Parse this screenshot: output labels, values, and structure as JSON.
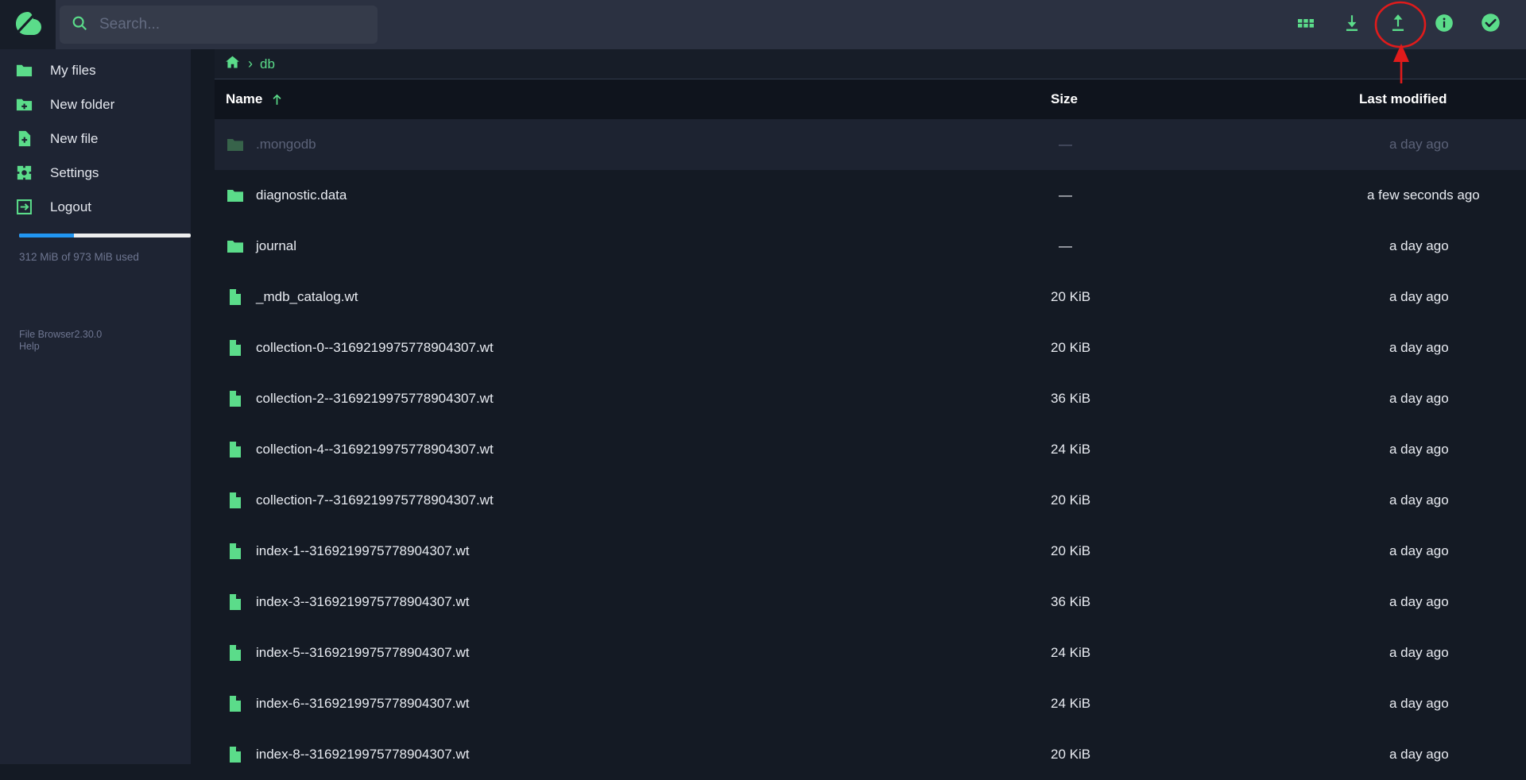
{
  "app": {
    "logo": "filebrowser-cloud-logo",
    "name": "File Browser",
    "version": "2.30.0",
    "version_line": "File Browser2.30.0",
    "help_label": "Help",
    "accent_green": "#5bdc8a",
    "accent_blue": "#2196f3",
    "annotation_red": "#e01b1b",
    "bg_dark": "#141a24",
    "bg_sidebar": "#1e2433",
    "bg_topbar": "#2b3141"
  },
  "search": {
    "placeholder": "Search...",
    "value": "",
    "icon": "search-icon"
  },
  "toolbar": {
    "items": [
      {
        "name": "switch-view-button",
        "icon": "grid-view-icon",
        "label": "Switch view"
      },
      {
        "name": "download-button",
        "icon": "download-icon",
        "label": "Download",
        "highlighted": true
      },
      {
        "name": "upload-button",
        "icon": "upload-icon",
        "label": "Upload"
      },
      {
        "name": "info-button",
        "icon": "info-icon",
        "label": "Info"
      },
      {
        "name": "select-multiple-button",
        "icon": "check-circle-icon",
        "label": "Select multiple"
      }
    ]
  },
  "sidebar": {
    "items": [
      {
        "label": "My files",
        "icon": "folder-icon",
        "name": "sidebar-item-my-files"
      },
      {
        "label": "New folder",
        "icon": "folder-plus-icon",
        "name": "sidebar-item-new-folder"
      },
      {
        "label": "New file",
        "icon": "file-plus-icon",
        "name": "sidebar-item-new-file"
      },
      {
        "label": "Settings",
        "icon": "gear-icon",
        "name": "sidebar-item-settings"
      },
      {
        "label": "Logout",
        "icon": "logout-icon",
        "name": "sidebar-item-logout"
      }
    ],
    "usage": {
      "text": "312 MiB of 973 MiB used",
      "used": "312 MiB",
      "total": "973 MiB",
      "percent": 32
    }
  },
  "breadcrumb": {
    "home_icon": "home-icon",
    "separator": "›",
    "items": [
      {
        "label": "db",
        "name": "breadcrumb-item-db"
      }
    ]
  },
  "table": {
    "columns": [
      {
        "key": "name",
        "label": "Name",
        "sorted": true,
        "sort_icon": "arrow-up-icon"
      },
      {
        "key": "size",
        "label": "Size"
      },
      {
        "key": "modified",
        "label": "Last modified"
      }
    ],
    "rows": [
      {
        "name": ".mongodb",
        "type": "folder",
        "size": "—",
        "modified": "a day ago",
        "hidden": true,
        "highlight": true
      },
      {
        "name": "diagnostic.data",
        "type": "folder",
        "size": "—",
        "modified": "a few seconds ago"
      },
      {
        "name": "journal",
        "type": "folder",
        "size": "—",
        "modified": "a day ago"
      },
      {
        "name": "_mdb_catalog.wt",
        "type": "file",
        "size": "20 KiB",
        "modified": "a day ago"
      },
      {
        "name": "collection-0--3169219975778904307.wt",
        "type": "file",
        "size": "20 KiB",
        "modified": "a day ago"
      },
      {
        "name": "collection-2--3169219975778904307.wt",
        "type": "file",
        "size": "36 KiB",
        "modified": "a day ago"
      },
      {
        "name": "collection-4--3169219975778904307.wt",
        "type": "file",
        "size": "24 KiB",
        "modified": "a day ago"
      },
      {
        "name": "collection-7--3169219975778904307.wt",
        "type": "file",
        "size": "20 KiB",
        "modified": "a day ago"
      },
      {
        "name": "index-1--3169219975778904307.wt",
        "type": "file",
        "size": "20 KiB",
        "modified": "a day ago"
      },
      {
        "name": "index-3--3169219975778904307.wt",
        "type": "file",
        "size": "36 KiB",
        "modified": "a day ago"
      },
      {
        "name": "index-5--3169219975778904307.wt",
        "type": "file",
        "size": "24 KiB",
        "modified": "a day ago"
      },
      {
        "name": "index-6--3169219975778904307.wt",
        "type": "file",
        "size": "24 KiB",
        "modified": "a day ago"
      },
      {
        "name": "index-8--3169219975778904307.wt",
        "type": "file",
        "size": "20 KiB",
        "modified": "a day ago"
      }
    ]
  },
  "annotation": {
    "shape": "circle-with-arrow",
    "target": "download-button",
    "color": "#e01b1b"
  }
}
